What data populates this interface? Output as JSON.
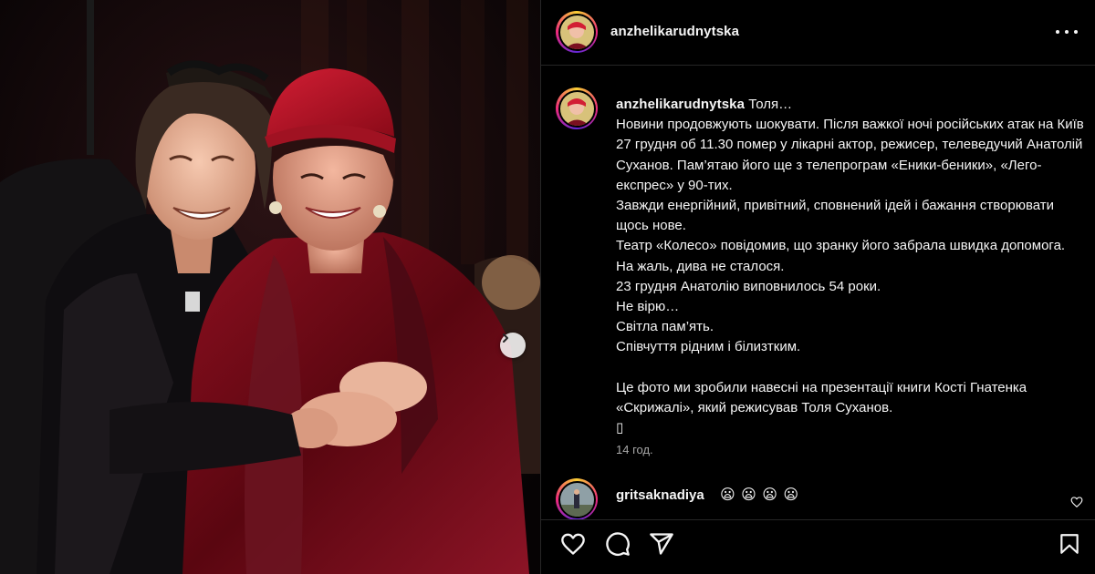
{
  "post": {
    "author": "anzhelikarudnytska",
    "caption_first_line": "Толя…",
    "caption_body": "Новини продовжують шокувати. Після важкої ночі російських атак на Київ 27 грудня об 11.30 помер у лікарні актор, режисер, телеведучий Анатолій Суханов. Пам’ятаю його ще з телепрограм «Еники-беники», «Лего-експрес» у 90-тих.\nЗавжди енергійний, привітний, сповнений ідей і бажання створювати щось нове.\nТеатр «Колесо» повідомив, що зранку його забрала швидка допомога. На жаль, дива не сталося.\n23 грудня Анатолію виповнилось 54 роки.\nНе вірю…\nСвітла пам’ять.\nСпівчуття рідним і білизтким.\n\nЦе фото ми зробили навесні на презентації книги Кості Гнатенка «Скрижалі», який режисував Толя Суханов.\n▯",
    "time_ago": "14 год."
  },
  "comment": {
    "user": "gritsaknadiya",
    "text": "😦 😦 😦 😦"
  },
  "colors": {
    "background": "#000000",
    "text": "#f5f5f5",
    "muted": "#a8a8a8",
    "divider": "#262626"
  },
  "icons": {
    "more": "more-horizontal-icon",
    "carousel": "chevron-right-icon",
    "like": "heart-icon",
    "comment": "comment-bubble-icon",
    "share": "paper-plane-icon",
    "save": "bookmark-icon"
  }
}
